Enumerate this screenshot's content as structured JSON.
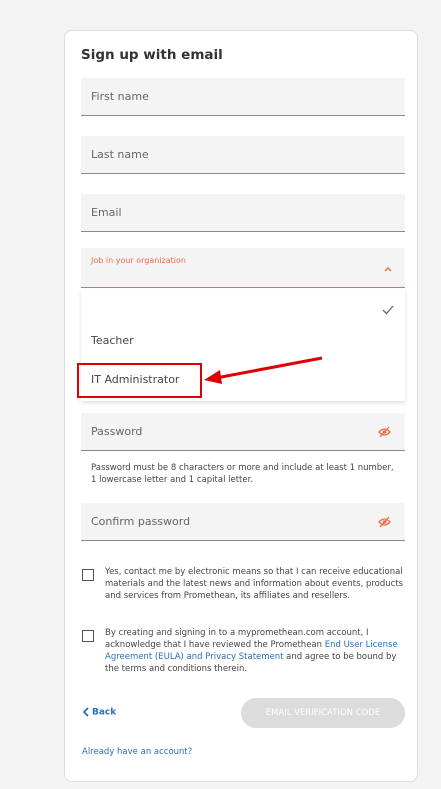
{
  "form": {
    "title": "Sign up with email",
    "first_name_placeholder": "First name",
    "last_name_placeholder": "Last name",
    "email_placeholder": "Email",
    "job_label": "Job in your organization",
    "password_placeholder": "Password",
    "password_hint": "Password must be 8 characters or more and include at least 1 number, 1 lowercase letter and 1 capital letter.",
    "confirm_password_placeholder": "Confirm password"
  },
  "dropdown": {
    "options": [
      "Teacher",
      "IT Administrator"
    ]
  },
  "consent": {
    "contact_text": "Yes, contact me by electronic means so that I can receive educational materials and the latest news and information about events, products and services from Promethean, its affiliates and resellers.",
    "terms_prefix": "By creating and signing in to a mypromethean.com account, I acknowledge that I have reviewed the Promethean ",
    "terms_link": "End User License Agreement (EULA) and Privacy Statement",
    "terms_suffix": " and agree to be bound by the terms and conditions therein."
  },
  "actions": {
    "back_label": "Back",
    "verify_label": "EMAIL VERIFICATION CODE",
    "already_label": "Already have an account?"
  },
  "colors": {
    "accent": "#ef6c47",
    "link": "#2a6fb8",
    "highlight": "#e00000"
  }
}
